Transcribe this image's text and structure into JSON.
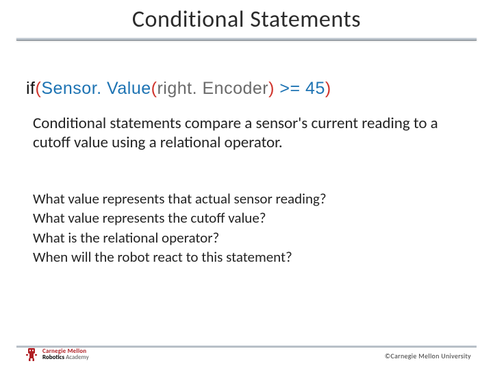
{
  "title": "Conditional Statements",
  "code": {
    "keyword": "if",
    "openParen": "(",
    "func": "Sensor. Value",
    "argOpen": "(",
    "arg": "right. Encoder",
    "argClose": ")",
    "space": " ",
    "op": ">=",
    "num": "45",
    "closeParen": ")"
  },
  "paragraph": "Conditional statements compare a sensor's current reading to a cutoff value using a relational operator.",
  "questions": {
    "q1": "What value represents that actual sensor reading?",
    "q2": "What value represents the cutoff value?",
    "q3": "What is the relational operator?",
    "q4": "When will the robot react to this statement?"
  },
  "footer": {
    "copyright": "©Carnegie Mellon University",
    "logo_cm": "Carnegie Mellon",
    "logo_robotics": "Robotics",
    "logo_academy": "Academy"
  }
}
